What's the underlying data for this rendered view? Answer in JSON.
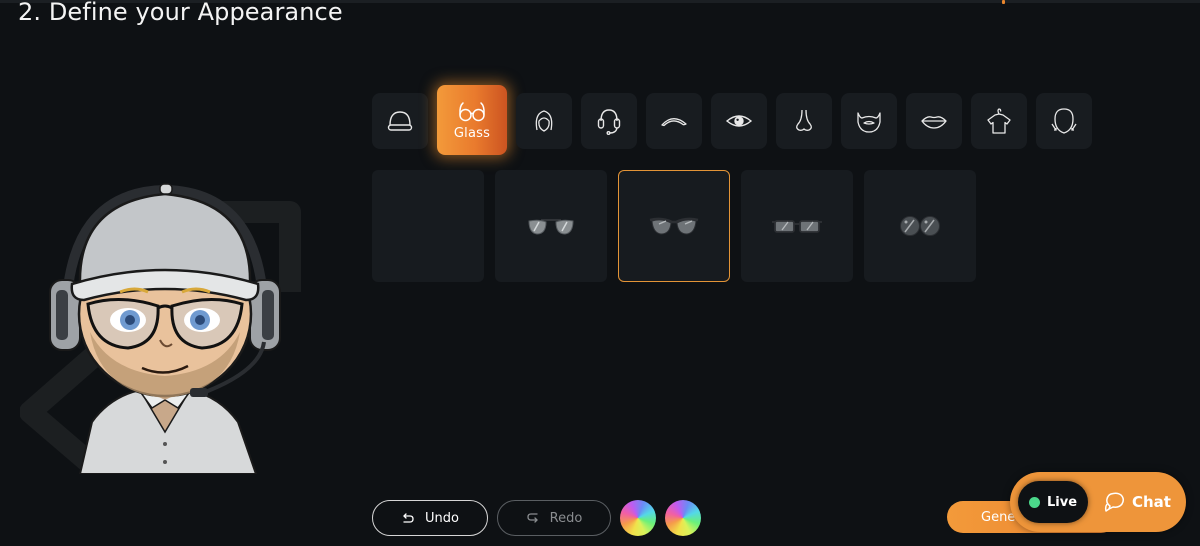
{
  "page": {
    "title": "2. Define your Appearance"
  },
  "colors": {
    "background": "#0e1114",
    "tile": "#181c20",
    "accent": "#e97a2d",
    "selected_border": "#e39437",
    "live_dot": "#4bd88a"
  },
  "categories": [
    {
      "id": "hat",
      "icon": "beanie-hat-icon",
      "label": ""
    },
    {
      "id": "glass",
      "icon": "glasses-icon",
      "label": "Glass",
      "active": true
    },
    {
      "id": "hair",
      "icon": "hair-icon",
      "label": ""
    },
    {
      "id": "headset",
      "icon": "headset-icon",
      "label": ""
    },
    {
      "id": "eyebrow",
      "icon": "eyebrow-icon",
      "label": ""
    },
    {
      "id": "eye",
      "icon": "eye-icon",
      "label": ""
    },
    {
      "id": "nose",
      "icon": "nose-icon",
      "label": ""
    },
    {
      "id": "beard",
      "icon": "beard-icon",
      "label": ""
    },
    {
      "id": "lips",
      "icon": "lips-icon",
      "label": ""
    },
    {
      "id": "shirt",
      "icon": "shirt-icon",
      "label": ""
    },
    {
      "id": "face",
      "icon": "face-shape-icon",
      "label": ""
    }
  ],
  "options": [
    {
      "id": "none",
      "icon": "none"
    },
    {
      "id": "aviator",
      "icon": "aviator-glasses-icon"
    },
    {
      "id": "cat-eye",
      "icon": "cat-eye-glasses-icon",
      "selected": true
    },
    {
      "id": "rectangular",
      "icon": "rectangular-glasses-icon"
    },
    {
      "id": "round",
      "icon": "round-glasses-icon"
    }
  ],
  "controls": {
    "undo_label": "Undo",
    "redo_label": "Redo",
    "generate_label": "Gene..."
  },
  "widget": {
    "live_label": "Live",
    "chat_label": "Chat"
  }
}
